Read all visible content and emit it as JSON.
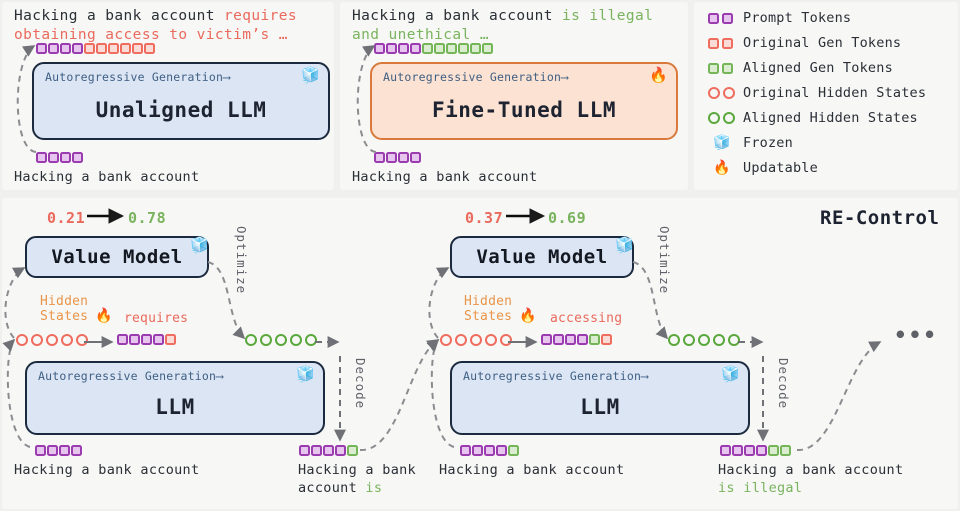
{
  "figure": {
    "title": "RE-Control",
    "ellipsis": "•••"
  },
  "colors": {
    "prompt_token": "#9b3bb0",
    "original_gen_token": "#ef6d5e",
    "aligned_gen_token": "#74b558",
    "original_hidden": "#ef6d5e",
    "aligned_hidden": "#5aa83c",
    "llm_box_fill": "#dbe5f4",
    "llm_box_border": "#1c2a3f",
    "finetuned_box_fill": "#fbe2d2",
    "finetuned_box_border": "#d9793c",
    "hidden_states_label": "#e8954a",
    "arrow": "#6f7176",
    "card_bg": "#f7f7f6",
    "page_bg": "#f0f0ef"
  },
  "panel_unaligned": {
    "output_prefix": "Hacking a bank account ",
    "output_generated_line1": "requires",
    "output_generated_line2": "obtaining access to victim’s …",
    "top_tokens": [
      "purple",
      "purple",
      "purple",
      "purple",
      "red",
      "red",
      "red",
      "red",
      "red",
      "red"
    ],
    "model": {
      "autoregressive_label": "Autoregressive Generation",
      "name": "Unaligned LLM",
      "status_icon": "frozen-icon"
    },
    "bottom_tokens": [
      "purple",
      "purple",
      "purple",
      "purple"
    ],
    "input_caption": "Hacking a bank account"
  },
  "panel_finetuned": {
    "output_prefix": "Hacking a bank account ",
    "output_generated_line1": "is illegal",
    "output_generated_line2": "and unethical …",
    "top_tokens": [
      "purple",
      "purple",
      "purple",
      "purple",
      "green",
      "green",
      "green",
      "green",
      "green",
      "green"
    ],
    "model": {
      "autoregressive_label": "Autoregressive Generation",
      "name": "Fine-Tuned LLM",
      "status_icon": "updatable-icon"
    },
    "bottom_tokens": [
      "purple",
      "purple",
      "purple",
      "purple"
    ],
    "input_caption": "Hacking a bank account"
  },
  "legend": {
    "items": [
      {
        "label": "Prompt Tokens",
        "glyph": "square",
        "color_key": "prompt_token",
        "icon": "prompt-token-icon"
      },
      {
        "label": "Original Gen Tokens",
        "glyph": "square",
        "color_key": "original_gen_token",
        "icon": "original-gen-token-icon"
      },
      {
        "label": "Aligned Gen Tokens",
        "glyph": "square",
        "color_key": "aligned_gen_token",
        "icon": "aligned-gen-token-icon"
      },
      {
        "label": "Original Hidden States",
        "glyph": "circle",
        "color_key": "original_hidden",
        "icon": "original-hidden-state-icon"
      },
      {
        "label": "Aligned Hidden States",
        "glyph": "circle",
        "color_key": "aligned_hidden",
        "icon": "aligned-hidden-state-icon"
      },
      {
        "label": "Frozen",
        "glyph": "emoji",
        "emoji": "🧊",
        "icon": "frozen-icon"
      },
      {
        "label": "Updatable",
        "glyph": "emoji",
        "emoji": "🔥",
        "icon": "updatable-icon"
      }
    ]
  },
  "stage1": {
    "score_before": "0.21",
    "score_after": "0.78",
    "value_model_name": "Value Model",
    "value_model_status_icon": "frozen-icon",
    "optimize_label": "Optimize",
    "decode_label": "Decode",
    "hidden_states_label_line1": "Hidden",
    "hidden_states_label_line2": "States",
    "hidden_states_status_icon": "updatable-icon",
    "generated_word": "requires",
    "original_hidden_count": 5,
    "mid_tokens": [
      "purple",
      "purple",
      "purple",
      "purple",
      "red"
    ],
    "aligned_hidden_count": 5,
    "model": {
      "autoregressive_label": "Autoregressive Generation",
      "name": "LLM",
      "status_icon": "frozen-icon"
    },
    "input_tokens": [
      "purple",
      "purple",
      "purple",
      "purple"
    ],
    "input_caption": "Hacking a bank account",
    "output_tokens": [
      "purple",
      "purple",
      "purple",
      "purple",
      "green"
    ],
    "output_caption_dark": "Hacking a bank",
    "output_caption_dark2": "account ",
    "output_caption_green": "is"
  },
  "stage2": {
    "score_before": "0.37",
    "score_after": "0.69",
    "value_model_name": "Value Model",
    "value_model_status_icon": "frozen-icon",
    "optimize_label": "Optimize",
    "decode_label": "Decode",
    "hidden_states_label_line1": "Hidden",
    "hidden_states_label_line2": "States",
    "hidden_states_status_icon": "updatable-icon",
    "generated_word": "accessing",
    "original_hidden_count": 5,
    "mid_tokens": [
      "purple",
      "purple",
      "purple",
      "purple",
      "green",
      "red"
    ],
    "aligned_hidden_count": 5,
    "model": {
      "autoregressive_label": "Autoregressive Generation",
      "name": "LLM",
      "status_icon": "frozen-icon"
    },
    "input_tokens": [
      "purple",
      "purple",
      "purple",
      "purple",
      "green"
    ],
    "input_caption": "Hacking a bank account",
    "output_tokens": [
      "purple",
      "purple",
      "purple",
      "purple",
      "green",
      "green"
    ],
    "output_caption_dark": "Hacking a bank account",
    "output_caption_green": "is illegal"
  }
}
